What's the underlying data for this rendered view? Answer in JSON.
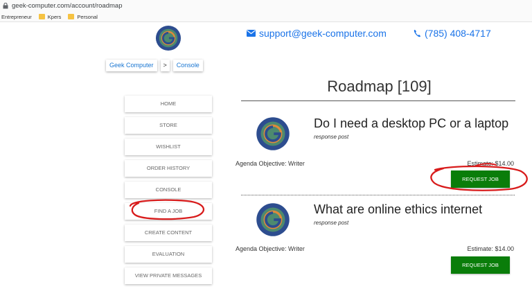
{
  "browser": {
    "url": "geek-computer.com/account/roadmap",
    "bookmarks": [
      "Entrepreneur",
      "Kpers",
      "Personal"
    ]
  },
  "header": {
    "email": "support@geek-computer.com",
    "phone": "(785) 408-4717"
  },
  "breadcrumb": {
    "home": "Geek Computer",
    "separator": ">",
    "current": "Console"
  },
  "nav": {
    "items": [
      "HOME",
      "STORE",
      "WISHLIST",
      "ORDER HISTORY",
      "CONSOLE",
      "FIND A JOB",
      "CREATE CONTENT",
      "EVALUATION",
      "VIEW PRIVATE MESSAGES"
    ]
  },
  "main": {
    "title": "Roadmap [109]"
  },
  "posts": [
    {
      "title": "Do I need a desktop PC or a laptop",
      "subtitle": "response post",
      "agenda": "Agenda Objective: Writer",
      "estimate": "Estimate: $14.00",
      "button": "REQUEST JOB"
    },
    {
      "title": "What are online ethics internet",
      "subtitle": "response post",
      "agenda": "Agenda Objective: Writer",
      "estimate": "Estimate: $14.00",
      "button": "REQUEST JOB"
    }
  ],
  "colors": {
    "link": "#1a73e8",
    "button": "#0a7d0a",
    "annotation": "#d81b1b"
  }
}
